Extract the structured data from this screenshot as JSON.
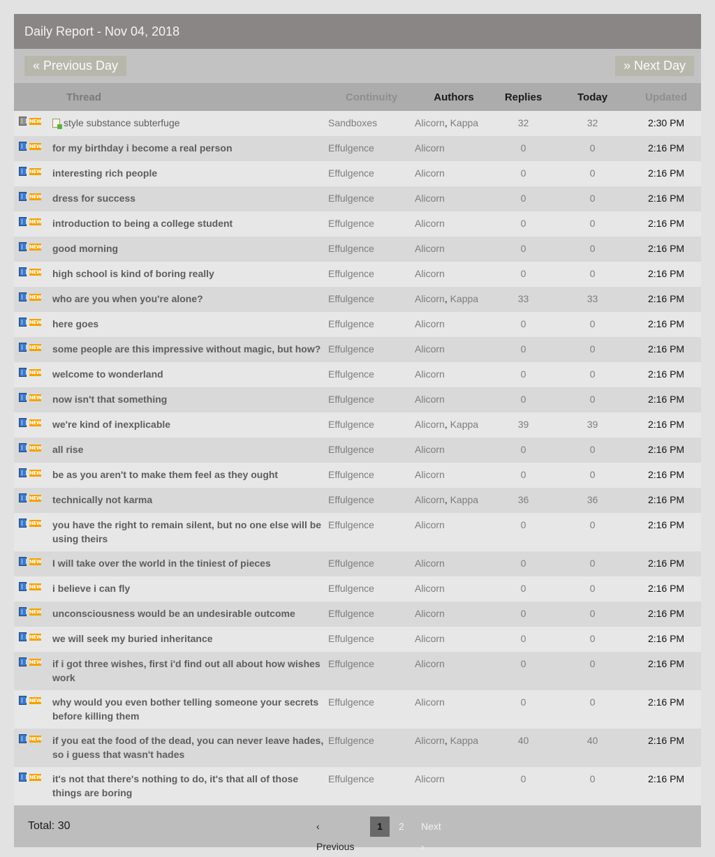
{
  "header": {
    "title": "Daily Report - Nov 04, 2018"
  },
  "nav": {
    "prev_label": "« Previous Day",
    "next_label": "» Next Day"
  },
  "columns": {
    "thread": "Thread",
    "continuity": "Continuity",
    "authors": "Authors",
    "replies": "Replies",
    "today": "Today",
    "updated": "Updated"
  },
  "rows": [
    {
      "title": "style substance subterfuge",
      "continuity": "Sandboxes",
      "authors": [
        "Alicorn",
        "Kappa"
      ],
      "replies": "32",
      "today": "32",
      "updated": "2:30 PM",
      "sandbox": true
    },
    {
      "title": "for my birthday i become a real person",
      "continuity": "Effulgence",
      "authors": [
        "Alicorn"
      ],
      "replies": "0",
      "today": "0",
      "updated": "2:16 PM"
    },
    {
      "title": "interesting rich people",
      "continuity": "Effulgence",
      "authors": [
        "Alicorn"
      ],
      "replies": "0",
      "today": "0",
      "updated": "2:16 PM"
    },
    {
      "title": "dress for success",
      "continuity": "Effulgence",
      "authors": [
        "Alicorn"
      ],
      "replies": "0",
      "today": "0",
      "updated": "2:16 PM"
    },
    {
      "title": "introduction to being a college student",
      "continuity": "Effulgence",
      "authors": [
        "Alicorn"
      ],
      "replies": "0",
      "today": "0",
      "updated": "2:16 PM"
    },
    {
      "title": "good morning",
      "continuity": "Effulgence",
      "authors": [
        "Alicorn"
      ],
      "replies": "0",
      "today": "0",
      "updated": "2:16 PM"
    },
    {
      "title": "high school is kind of boring really",
      "continuity": "Effulgence",
      "authors": [
        "Alicorn"
      ],
      "replies": "0",
      "today": "0",
      "updated": "2:16 PM"
    },
    {
      "title": "who are you when you're alone?",
      "continuity": "Effulgence",
      "authors": [
        "Alicorn",
        "Kappa"
      ],
      "replies": "33",
      "today": "33",
      "updated": "2:16 PM"
    },
    {
      "title": "here goes",
      "continuity": "Effulgence",
      "authors": [
        "Alicorn"
      ],
      "replies": "0",
      "today": "0",
      "updated": "2:16 PM"
    },
    {
      "title": "some people are this impressive without magic, but how?",
      "continuity": "Effulgence",
      "authors": [
        "Alicorn"
      ],
      "replies": "0",
      "today": "0",
      "updated": "2:16 PM"
    },
    {
      "title": "welcome to wonderland",
      "continuity": "Effulgence",
      "authors": [
        "Alicorn"
      ],
      "replies": "0",
      "today": "0",
      "updated": "2:16 PM"
    },
    {
      "title": "now isn't that something",
      "continuity": "Effulgence",
      "authors": [
        "Alicorn"
      ],
      "replies": "0",
      "today": "0",
      "updated": "2:16 PM"
    },
    {
      "title": "we're kind of inexplicable",
      "continuity": "Effulgence",
      "authors": [
        "Alicorn",
        "Kappa"
      ],
      "replies": "39",
      "today": "39",
      "updated": "2:16 PM"
    },
    {
      "title": "all rise",
      "continuity": "Effulgence",
      "authors": [
        "Alicorn"
      ],
      "replies": "0",
      "today": "0",
      "updated": "2:16 PM"
    },
    {
      "title": "be as you aren't to make them feel as they ought",
      "continuity": "Effulgence",
      "authors": [
        "Alicorn"
      ],
      "replies": "0",
      "today": "0",
      "updated": "2:16 PM"
    },
    {
      "title": "technically not karma",
      "continuity": "Effulgence",
      "authors": [
        "Alicorn",
        "Kappa"
      ],
      "replies": "36",
      "today": "36",
      "updated": "2:16 PM"
    },
    {
      "title": "you have the right to remain silent, but no one else will be using theirs",
      "continuity": "Effulgence",
      "authors": [
        "Alicorn"
      ],
      "replies": "0",
      "today": "0",
      "updated": "2:16 PM"
    },
    {
      "title": "I will take over the world in the tiniest of pieces",
      "continuity": "Effulgence",
      "authors": [
        "Alicorn"
      ],
      "replies": "0",
      "today": "0",
      "updated": "2:16 PM"
    },
    {
      "title": "i believe i can fly",
      "continuity": "Effulgence",
      "authors": [
        "Alicorn"
      ],
      "replies": "0",
      "today": "0",
      "updated": "2:16 PM"
    },
    {
      "title": "unconsciousness would be an undesirable outcome",
      "continuity": "Effulgence",
      "authors": [
        "Alicorn"
      ],
      "replies": "0",
      "today": "0",
      "updated": "2:16 PM"
    },
    {
      "title": "we will seek my buried inheritance",
      "continuity": "Effulgence",
      "authors": [
        "Alicorn"
      ],
      "replies": "0",
      "today": "0",
      "updated": "2:16 PM"
    },
    {
      "title": "if i got three wishes, first i'd find out all about how wishes work",
      "continuity": "Effulgence",
      "authors": [
        "Alicorn"
      ],
      "replies": "0",
      "today": "0",
      "updated": "2:16 PM"
    },
    {
      "title": "why would you even bother telling someone your secrets before killing them",
      "continuity": "Effulgence",
      "authors": [
        "Alicorn"
      ],
      "replies": "0",
      "today": "0",
      "updated": "2:16 PM"
    },
    {
      "title": "if you eat the food of the dead, you can never leave hades, so i guess that wasn't hades",
      "continuity": "Effulgence",
      "authors": [
        "Alicorn",
        "Kappa"
      ],
      "replies": "40",
      "today": "40",
      "updated": "2:16 PM"
    },
    {
      "title": "it's not that there's nothing to do, it's that all of those things are boring",
      "continuity": "Effulgence",
      "authors": [
        "Alicorn"
      ],
      "replies": "0",
      "today": "0",
      "updated": "2:16 PM"
    }
  ],
  "badges": {
    "new": "NEW"
  },
  "footer": {
    "total": "Total: 30",
    "pager": {
      "prev": "‹ Previous",
      "current": "1",
      "page2": "2",
      "next": "Next ›"
    }
  }
}
